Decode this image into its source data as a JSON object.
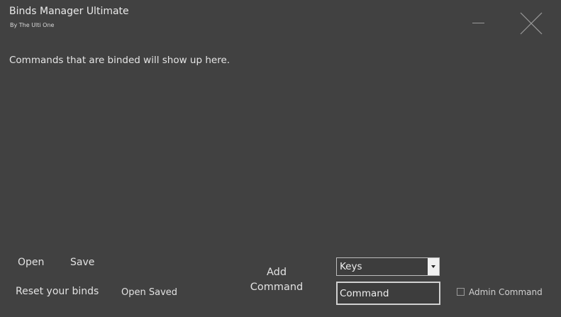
{
  "window": {
    "title": "Binds Manager Ultimate",
    "subtitle": "By The Ulti One"
  },
  "info": {
    "message": "Commands that are binded will show up here."
  },
  "buttons": {
    "open": "Open",
    "save": "Save",
    "reset": "Reset your binds",
    "open_saved": "Open Saved",
    "add_line1": "Add",
    "add_line2": "Command"
  },
  "keys_dropdown": {
    "selected": "Keys"
  },
  "command_input": {
    "placeholder": "Command",
    "value": ""
  },
  "admin_checkbox": {
    "label": "Admin Command",
    "checked": false
  },
  "icons": {
    "minimize": "minimize-icon",
    "close": "close-icon"
  },
  "colors": {
    "background": "#414141",
    "text": "#e6e6e6",
    "dropdown_arrow_bg": "#f0f0f0"
  }
}
